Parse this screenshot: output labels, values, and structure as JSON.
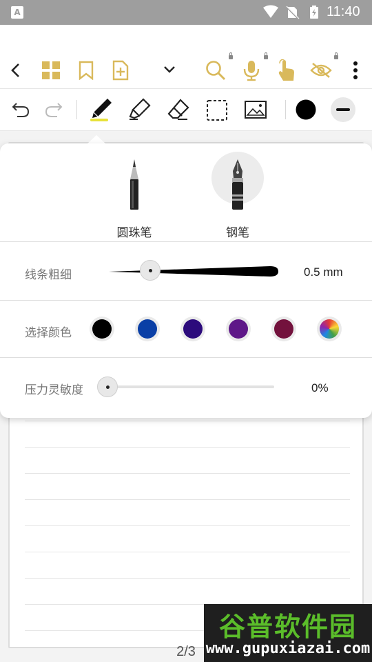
{
  "status_bar": {
    "app_badge": "A",
    "time": "11:40"
  },
  "colors": {
    "accent": "#d9b95b",
    "palette": [
      "#000000",
      "#0a3fa6",
      "#2c0b7c",
      "#5e1788",
      "#73123d",
      "rainbow"
    ]
  },
  "pen_popup": {
    "pens": [
      {
        "label": "圆珠笔",
        "selected": false
      },
      {
        "label": "钢笔",
        "selected": true
      }
    ],
    "thickness": {
      "label": "线条粗细",
      "value": "0.5 mm"
    },
    "color": {
      "label": "选择颜色"
    },
    "pressure": {
      "label": "压力灵敏度",
      "value": "0%"
    }
  },
  "page_indicator": "2/3",
  "watermark": {
    "title": "谷普软件园",
    "url": "www.gupuxiazai.com"
  }
}
